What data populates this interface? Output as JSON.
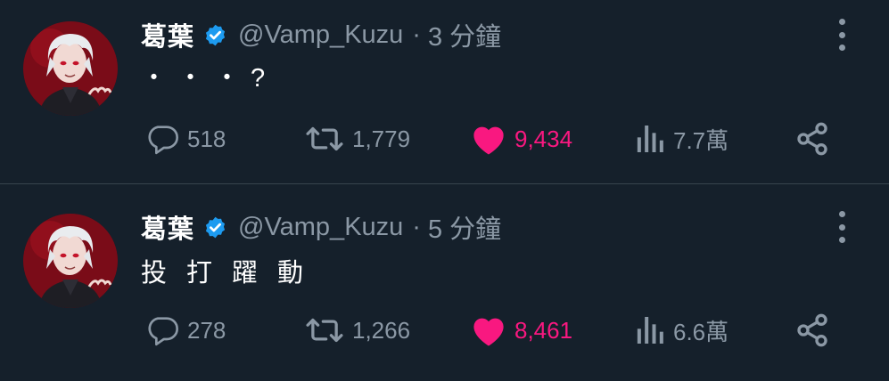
{
  "theme": {
    "background": "#15202b",
    "divider": "#38444d",
    "muted": "#8b98a5",
    "like": "#f91880",
    "verified": "#1d9bf0"
  },
  "tweets": [
    {
      "name": "葛葉",
      "handle": "@Vamp_Kuzu",
      "separator": "·",
      "time": "3 分鐘",
      "text": "・・・?",
      "replies": "518",
      "retweets": "1,779",
      "likes": "9,434",
      "views": "7.7萬",
      "liked": true
    },
    {
      "name": "葛葉",
      "handle": "@Vamp_Kuzu",
      "separator": "·",
      "time": "5 分鐘",
      "text": "投打躍動",
      "replies": "278",
      "retweets": "1,266",
      "likes": "8,461",
      "views": "6.6萬",
      "liked": true
    }
  ]
}
